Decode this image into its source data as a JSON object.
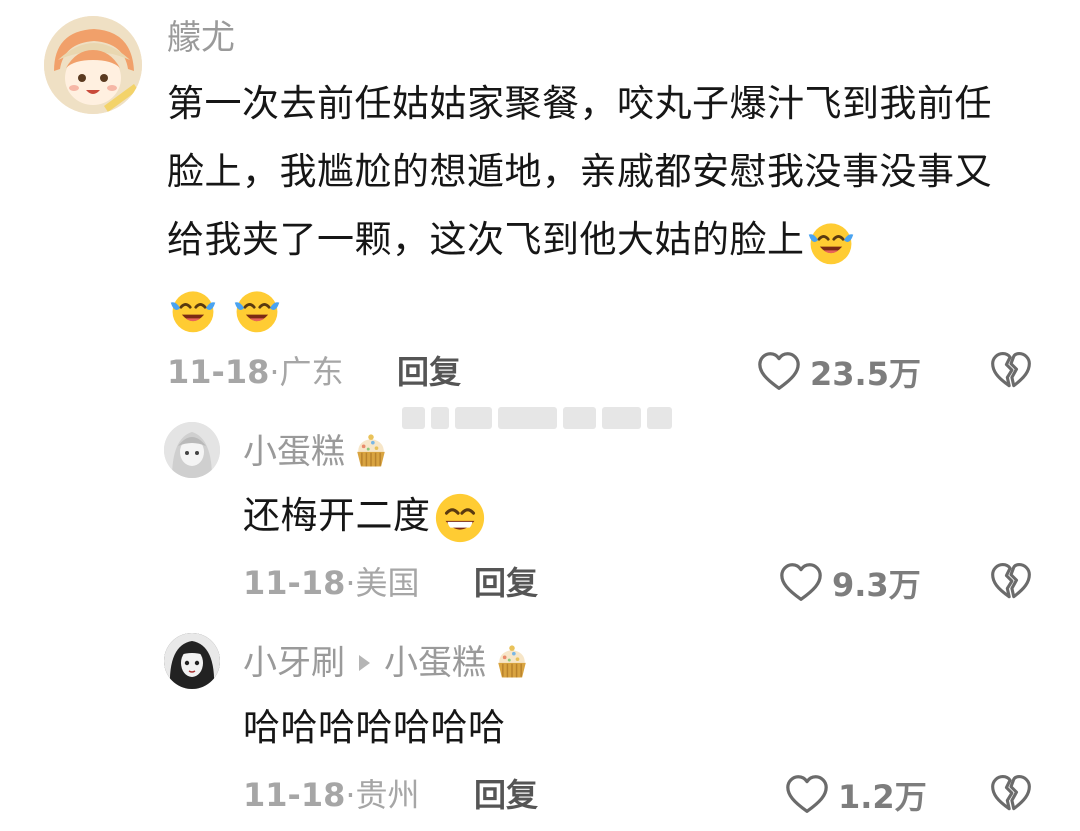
{
  "comments": [
    {
      "author": "艨尤",
      "text": "第一次去前任姑姑家聚餐，咬丸子爆汁飞到我前任脸上，我尴尬的想遁地，亲戚都安慰我没事没事又给我夹了一颗，这次飞到他大姑的脸上",
      "emojis": [
        "crying-laughing-emoji",
        "crying-laughing-emoji",
        "crying-laughing-emoji"
      ],
      "date": "11-18",
      "location": "广东",
      "reply_label": "回复",
      "likes": "23.5万"
    },
    {
      "author": "小蛋糕",
      "author_badge": "cupcake-icon",
      "text": "还梅开二度",
      "emojis": [
        "grinning-emoji"
      ],
      "date": "11-18",
      "location": "美国",
      "reply_label": "回复",
      "likes": "9.3万"
    },
    {
      "author": "小牙刷",
      "reply_to": "小蛋糕",
      "reply_to_badge": "cupcake-icon",
      "text": "哈哈哈哈哈哈哈",
      "date": "11-18",
      "location": "贵州",
      "reply_label": "回复",
      "likes": "1.2万"
    }
  ],
  "meta_separator": "·",
  "colors": {
    "text": "#161616",
    "muted": "#9a9a9a",
    "emoji_yellow": "#ffcc33",
    "tear_blue": "#4aa3f0"
  }
}
